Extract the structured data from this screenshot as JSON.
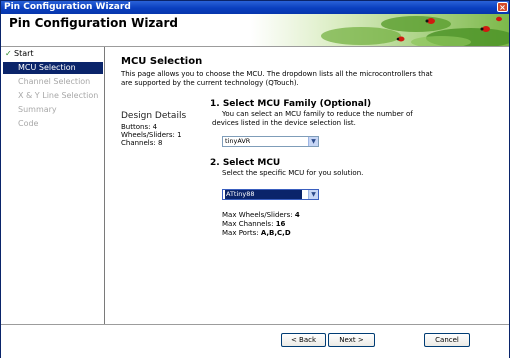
{
  "window": {
    "title": "Pin Configuration Wizard",
    "close_glyph": "×"
  },
  "header": {
    "title": "Pin Configuration Wizard"
  },
  "sidebar": {
    "items": [
      {
        "label": "Start",
        "state": "done",
        "check": "✓"
      },
      {
        "label": "MCU Selection",
        "state": "active"
      },
      {
        "label": "Channel Selection",
        "state": "disabled"
      },
      {
        "label": "X & Y Line Selection",
        "state": "disabled"
      },
      {
        "label": "Summary",
        "state": "disabled"
      },
      {
        "label": "Code",
        "state": "disabled"
      }
    ]
  },
  "page": {
    "title": "MCU Selection",
    "description": "This page allows you to choose the MCU. The dropdown lists all the microcontrollers that are supported by the current technology (QTouch).",
    "design_details": {
      "title": "Design Details",
      "buttons": "Buttons: 4",
      "wheels": "Wheels/Sliders: 1",
      "channels": "Channels: 8"
    },
    "family": {
      "heading": "1. Select MCU Family (Optional)",
      "help": "You can select an MCU family to reduce the number of devices listed in the device selection list.",
      "value": "tinyAVR"
    },
    "mcu": {
      "heading": "2. Select MCU",
      "help": "Select the specific MCU for you solution.",
      "value": "ATtiny88"
    },
    "stats": {
      "wheels_label": "Max Wheels/Sliders:",
      "wheels_value": "4",
      "channels_label": "Max Channels:",
      "channels_value": "16",
      "ports_label": "Max Ports:",
      "ports_value": "A,B,C,D"
    },
    "dropdown_arrow": "▼"
  },
  "footer": {
    "back": "< Back",
    "next": "Next >",
    "cancel": "Cancel"
  },
  "colors": {
    "title_bar": "#0a3fbf",
    "selection": "#0a246a",
    "check": "#2a8a2a"
  }
}
